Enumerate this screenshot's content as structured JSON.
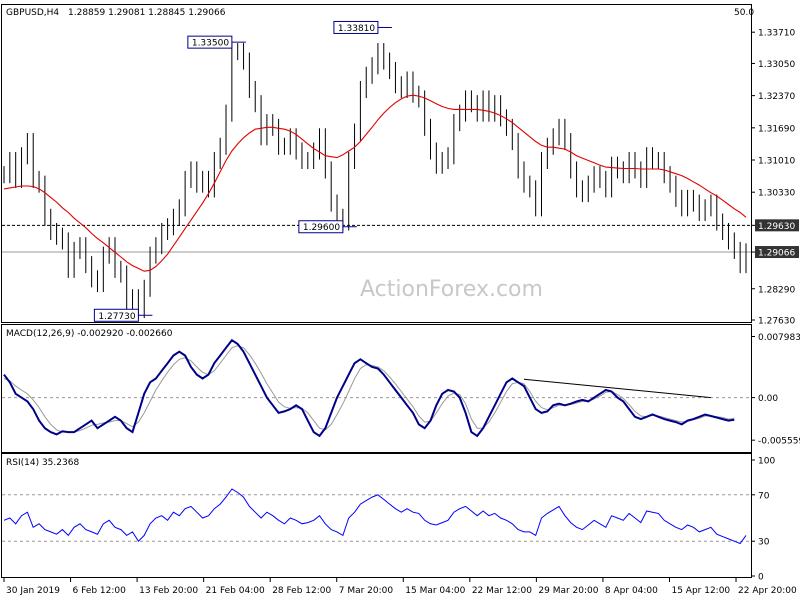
{
  "symbol": "GBPUSD,H4",
  "ohlc": "1.28859 1.29081 1.28845 1.29066",
  "watermark": "ActionForex.com",
  "corner_value": "50.0",
  "colors": {
    "price": "#000000",
    "ma": "#e00000",
    "macd": "#00008b",
    "signal": "#9a9a9a",
    "trend": "#000000",
    "rsi": "#0000ff"
  },
  "chart_data": {
    "type": "line",
    "x_labels": [
      "30 Jan 2019",
      "6 Feb 12:00",
      "13 Feb 20:00",
      "21 Feb 04:00",
      "28 Feb 12:00",
      "7 Mar 20:00",
      "15 Mar 04:00",
      "22 Mar 12:00",
      "29 Mar 20:00",
      "8 Apr 04:00",
      "15 Apr 12:00",
      "22 Apr 20:00"
    ],
    "price_panel": {
      "ylim": [
        1.2763,
        1.3401
      ],
      "ticks": [
        "1.33710",
        "1.33050",
        "1.32370",
        "1.31690",
        "1.31010",
        "1.30330",
        "1.29630",
        "1.29066",
        "1.28290",
        "1.27630"
      ],
      "tick_values": [
        1.3371,
        1.3305,
        1.3237,
        1.3169,
        1.3101,
        1.3033,
        1.2963,
        1.29066,
        1.2829,
        1.2763
      ],
      "hlines": [
        {
          "value": 1.2963,
          "label": "1.29630"
        },
        {
          "value": 1.29066,
          "label": "1.29066"
        }
      ],
      "annotations": [
        {
          "label": "1.27730",
          "x": 23,
          "value": 1.2773
        },
        {
          "label": "1.33500",
          "x": 39,
          "value": 1.335
        },
        {
          "label": "1.29600",
          "x": 58,
          "value": 1.296
        },
        {
          "label": "1.33810",
          "x": 64,
          "value": 1.3381
        }
      ],
      "close": [
        1.307,
        1.31,
        1.306,
        1.311,
        1.314,
        1.306,
        1.305,
        1.298,
        1.295,
        1.294,
        1.293,
        1.287,
        1.291,
        1.292,
        1.288,
        1.285,
        1.284,
        1.29,
        1.292,
        1.287,
        1.286,
        1.28,
        1.281,
        1.2785,
        1.283,
        1.29,
        1.292,
        1.295,
        1.296,
        1.298,
        1.3,
        1.306,
        1.308,
        1.305,
        1.306,
        1.304,
        1.31,
        1.313,
        1.32,
        1.333,
        1.333,
        1.331,
        1.325,
        1.322,
        1.315,
        1.318,
        1.317,
        1.313,
        1.313,
        1.315,
        1.312,
        1.31,
        1.31,
        1.312,
        1.315,
        1.308,
        1.301,
        1.298,
        1.297,
        1.31,
        1.316,
        1.325,
        1.328,
        1.33,
        1.333,
        1.331,
        1.329,
        1.326,
        1.325,
        1.327,
        1.324,
        1.323,
        1.317,
        1.312,
        1.309,
        1.31,
        1.311,
        1.318,
        1.32,
        1.323,
        1.322,
        1.32,
        1.323,
        1.32,
        1.322,
        1.319,
        1.317,
        1.314,
        1.308,
        1.305,
        1.304,
        1.3,
        1.31,
        1.313,
        1.315,
        1.317,
        1.314,
        1.308,
        1.304,
        1.303,
        1.305,
        1.307,
        1.306,
        1.304,
        1.309,
        1.308,
        1.307,
        1.31,
        1.308,
        1.306,
        1.311,
        1.31,
        1.31,
        1.307,
        1.305,
        1.302,
        1.3,
        1.302,
        1.301,
        1.299,
        1.3,
        1.301,
        1.297,
        1.295,
        1.293,
        1.291,
        1.288,
        1.2907
      ],
      "ma": [
        1.304,
        1.3042,
        1.3044,
        1.3046,
        1.3046,
        1.3045,
        1.304,
        1.3032,
        1.3022,
        1.3012,
        1.3,
        1.299,
        1.2978,
        1.2968,
        1.2958,
        1.2946,
        1.2935,
        1.2926,
        1.2916,
        1.2906,
        1.2896,
        1.2886,
        1.2878,
        1.2872,
        1.2866,
        1.2868,
        1.2876,
        1.2888,
        1.2902,
        1.292,
        1.2938,
        1.2956,
        1.2974,
        1.2992,
        1.301,
        1.303,
        1.3052,
        1.3076,
        1.31,
        1.312,
        1.3135,
        1.3148,
        1.3158,
        1.3166,
        1.3168,
        1.317,
        1.317,
        1.3168,
        1.3166,
        1.3162,
        1.3155,
        1.3145,
        1.3135,
        1.3125,
        1.3118,
        1.311,
        1.3108,
        1.3106,
        1.3112,
        1.312,
        1.3128,
        1.314,
        1.3155,
        1.317,
        1.3186,
        1.32,
        1.3212,
        1.3222,
        1.323,
        1.3236,
        1.3238,
        1.3236,
        1.3232,
        1.3226,
        1.322,
        1.3214,
        1.321,
        1.3208,
        1.3208,
        1.3208,
        1.3208,
        1.3208,
        1.3206,
        1.3204,
        1.32,
        1.3195,
        1.3188,
        1.318,
        1.317,
        1.316,
        1.315,
        1.314,
        1.3132,
        1.3128,
        1.3128,
        1.3126,
        1.3124,
        1.3118,
        1.311,
        1.3105,
        1.31,
        1.3095,
        1.309,
        1.3086,
        1.3085,
        1.3084,
        1.3083,
        1.3083,
        1.3083,
        1.3082,
        1.3082,
        1.3082,
        1.3082,
        1.308,
        1.3076,
        1.3072,
        1.3068,
        1.3062,
        1.3055,
        1.3048,
        1.304,
        1.3032,
        1.3025,
        1.3016,
        1.3007,
        1.2998,
        1.299,
        1.298
      ]
    },
    "macd_panel": {
      "title": "MACD(12,26,9) -0.002920 -0.002660",
      "ylim": [
        -0.00632,
        0.00857
      ],
      "ticks": [
        "0.007983",
        "0.00",
        "-0.005559"
      ],
      "tick_values": [
        0.007983,
        0.0,
        -0.005559
      ],
      "trendline": [
        {
          "x": 89,
          "value": 0.0024
        },
        {
          "x": 121,
          "value": 0.0
        }
      ],
      "macd": [
        0.003,
        0.002,
        0.0005,
        0.0,
        -0.0005,
        -0.0015,
        -0.003,
        -0.004,
        -0.0045,
        -0.0048,
        -0.0044,
        -0.0045,
        -0.0045,
        -0.004,
        -0.0035,
        -0.003,
        -0.004,
        -0.0035,
        -0.003,
        -0.0025,
        -0.003,
        -0.004,
        -0.0045,
        -0.002,
        0.0005,
        0.002,
        0.0025,
        0.0035,
        0.0045,
        0.0055,
        0.006,
        0.0055,
        0.004,
        0.003,
        0.0025,
        0.003,
        0.0045,
        0.0055,
        0.0065,
        0.0075,
        0.007,
        0.006,
        0.0045,
        0.003,
        0.0015,
        0.0,
        -0.001,
        -0.002,
        -0.0018,
        -0.0015,
        -0.001,
        -0.0015,
        -0.003,
        -0.0045,
        -0.005,
        -0.004,
        -0.002,
        0.0,
        0.0015,
        0.003,
        0.0045,
        0.005,
        0.0045,
        0.004,
        0.0038,
        0.003,
        0.002,
        0.001,
        0.0,
        -0.001,
        -0.002,
        -0.0035,
        -0.004,
        -0.003,
        -0.001,
        0.0005,
        0.001,
        0.0008,
        0.0,
        -0.002,
        -0.0045,
        -0.005,
        -0.004,
        -0.0025,
        -0.001,
        0.0005,
        0.002,
        0.0025,
        0.002,
        0.0015,
        0.0,
        -0.0015,
        -0.002,
        -0.0018,
        -0.001,
        -0.0008,
        -0.001,
        -0.0008,
        -0.0005,
        -0.0003,
        -0.0005,
        0.0,
        0.0005,
        0.001,
        0.0008,
        0.0,
        -0.0005,
        -0.0015,
        -0.0025,
        -0.0028,
        -0.0025,
        -0.0022,
        -0.0025,
        -0.0028,
        -0.003,
        -0.0032,
        -0.0035,
        -0.003,
        -0.0028,
        -0.0025,
        -0.0022,
        -0.0024,
        -0.0026,
        -0.0028,
        -0.003,
        -0.0029
      ],
      "signal": [
        0.0025,
        0.0022,
        0.0015,
        0.001,
        0.0005,
        -0.0003,
        -0.0013,
        -0.0025,
        -0.0035,
        -0.0042,
        -0.0045,
        -0.0045,
        -0.0045,
        -0.0043,
        -0.004,
        -0.0036,
        -0.0035,
        -0.0033,
        -0.0032,
        -0.003,
        -0.003,
        -0.0034,
        -0.0038,
        -0.0032,
        -0.002,
        -0.0005,
        0.001,
        0.0022,
        0.0033,
        0.0043,
        0.005,
        0.0052,
        0.0048,
        0.004,
        0.0033,
        0.003,
        0.0035,
        0.0045,
        0.0055,
        0.0065,
        0.0068,
        0.0065,
        0.0056,
        0.0045,
        0.0032,
        0.0018,
        0.0006,
        -0.0006,
        -0.0012,
        -0.0014,
        -0.0013,
        -0.0014,
        -0.002,
        -0.003,
        -0.004,
        -0.0042,
        -0.0035,
        -0.0022,
        -0.0008,
        0.0008,
        0.0025,
        0.0038,
        0.0043,
        0.0042,
        0.004,
        0.0035,
        0.0027,
        0.0018,
        0.0008,
        -0.0002,
        -0.0012,
        -0.0024,
        -0.0032,
        -0.0031,
        -0.002,
        -0.0008,
        0.0002,
        0.0006,
        0.0004,
        -0.0008,
        -0.0028,
        -0.004,
        -0.004,
        -0.0032,
        -0.002,
        -0.0006,
        0.0008,
        0.0018,
        0.002,
        0.0018,
        0.0008,
        -0.0005,
        -0.0013,
        -0.0016,
        -0.0013,
        -0.001,
        -0.001,
        -0.0009,
        -0.0007,
        -0.0005,
        -0.0005,
        -0.0002,
        0.0002,
        0.0007,
        0.0008,
        0.0004,
        -0.0001,
        -0.0009,
        -0.0018,
        -0.0024,
        -0.0025,
        -0.0023,
        -0.0024,
        -0.0026,
        -0.0028,
        -0.003,
        -0.0032,
        -0.0031,
        -0.0029,
        -0.0027,
        -0.0024,
        -0.0024,
        -0.0025,
        -0.0026,
        -0.0028,
        -0.0027
      ]
    },
    "rsi_panel": {
      "title": "RSI(14) 35.2368",
      "ylim": [
        0,
        100
      ],
      "ticks": [
        "100",
        "70",
        "30",
        "0"
      ],
      "tick_values": [
        100,
        70,
        30,
        0
      ],
      "levels": [
        70,
        30
      ],
      "rsi": [
        48,
        50,
        45,
        52,
        55,
        42,
        45,
        40,
        38,
        36,
        40,
        35,
        42,
        45,
        40,
        38,
        36,
        45,
        48,
        42,
        40,
        35,
        38,
        30,
        35,
        45,
        50,
        52,
        48,
        55,
        52,
        58,
        60,
        55,
        50,
        52,
        58,
        62,
        68,
        75,
        72,
        68,
        60,
        55,
        50,
        55,
        52,
        48,
        45,
        50,
        48,
        45,
        46,
        48,
        52,
        45,
        40,
        38,
        35,
        50,
        55,
        62,
        65,
        68,
        70,
        66,
        62,
        58,
        55,
        58,
        55,
        54,
        48,
        45,
        44,
        46,
        48,
        55,
        58,
        60,
        56,
        52,
        56,
        52,
        54,
        50,
        48,
        45,
        40,
        38,
        38,
        35,
        50,
        54,
        57,
        60,
        52,
        46,
        42,
        40,
        44,
        48,
        45,
        42,
        52,
        50,
        48,
        54,
        50,
        46,
        56,
        55,
        54,
        48,
        45,
        42,
        40,
        44,
        42,
        38,
        40,
        42,
        36,
        34,
        32,
        30,
        28,
        35
      ]
    }
  }
}
